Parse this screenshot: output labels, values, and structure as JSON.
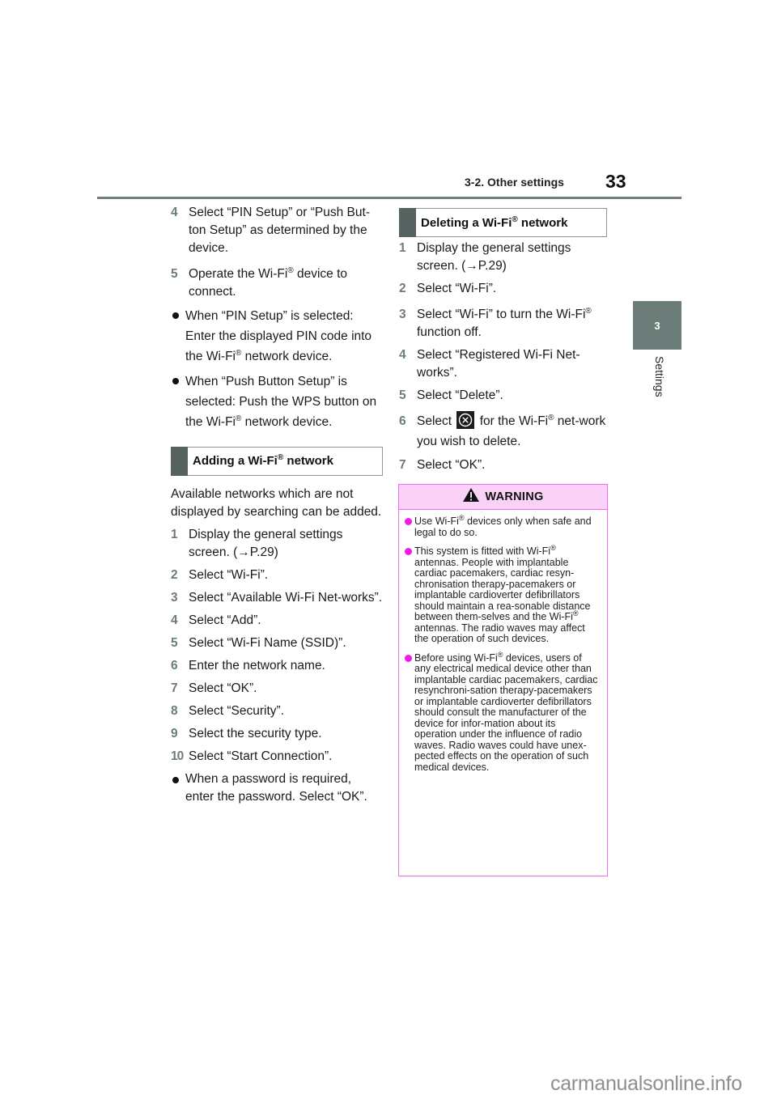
{
  "header": {
    "section": "3-2. Other settings",
    "page_number": "33"
  },
  "side_tab": {
    "chapter_number": "3",
    "chapter_label": "Settings"
  },
  "left_column": {
    "continued_steps": [
      {
        "num": "4",
        "text": "Select “PIN Setup” or “Push But-ton Setup” as determined by the device."
      },
      {
        "num": "5",
        "pre": "Operate the Wi-Fi",
        "sup": "®",
        "post": " device to connect."
      }
    ],
    "bullets": [
      {
        "pre": "When “PIN Setup” is selected: Enter the displayed PIN code into the Wi-Fi",
        "sup": "®",
        "post": " network device."
      },
      {
        "pre": "When “Push Button Setup” is selected: Push the WPS button on the Wi-Fi",
        "sup": "®",
        "post": " network device."
      }
    ],
    "adding_section": {
      "heading_pre": "Adding a Wi-Fi",
      "heading_sup": "®",
      "heading_post": " network",
      "intro": "Available networks which are not displayed by searching can be added.",
      "steps": [
        {
          "num": "1",
          "text": "Display the general settings screen. (→P.29)"
        },
        {
          "num": "2",
          "text": "Select “Wi-Fi”."
        },
        {
          "num": "3",
          "text": "Select “Available Wi-Fi Net-works”."
        },
        {
          "num": "4",
          "text": "Select “Add”."
        },
        {
          "num": "5",
          "text": "Select “Wi-Fi Name (SSID)”."
        },
        {
          "num": "6",
          "text": "Enter the network name."
        },
        {
          "num": "7",
          "text": "Select “OK”."
        },
        {
          "num": "8",
          "text": "Select “Security”."
        },
        {
          "num": "9",
          "text": "Select the security type."
        },
        {
          "num": "10",
          "text": "Select “Start Connection”."
        }
      ],
      "final_bullet": "When a password is required, enter the password. Select “OK”."
    }
  },
  "right_column": {
    "deleting_section": {
      "heading_pre": "Deleting a Wi-Fi",
      "heading_sup": "®",
      "heading_post": " network",
      "steps": [
        {
          "num": "1",
          "text": "Display the general settings screen. (→P.29)"
        },
        {
          "num": "2",
          "text": "Select “Wi-Fi”."
        },
        {
          "num": "3",
          "pre": "Select “Wi-Fi” to turn the Wi-Fi",
          "sup": "®",
          "post": " function off."
        },
        {
          "num": "4",
          "text": "Select “Registered Wi-Fi Net-works”."
        },
        {
          "num": "5",
          "text": "Select “Delete”."
        },
        {
          "num": "6",
          "pre": "Select",
          "icon": "delete-x-icon",
          "mid": " for the Wi-Fi",
          "sup": "®",
          "post": " net-work you wish to delete."
        },
        {
          "num": "7",
          "text": "Select “OK”."
        }
      ]
    },
    "warning": {
      "title": "WARNING",
      "icon": "warning-triangle-icon",
      "accent_color": "#f06de8",
      "header_bg": "#fbd2f7",
      "items": [
        {
          "pre": "Use Wi-Fi",
          "sup": "®",
          "post": " devices only when safe and legal to do so."
        },
        {
          "pre": "This system is fitted with Wi-Fi",
          "sup": "®",
          "mid": " antennas. People with implantable cardiac pacemakers, cardiac resyn-chronisation therapy-pacemakers or implantable cardioverter defibrillators should maintain a rea-sonable distance between them-selves and the Wi-Fi",
          "sup2": "®",
          "post": " antennas. The radio waves may affect the operation of such devices."
        },
        {
          "pre": "Before using Wi-Fi",
          "sup": "®",
          "post": " devices, users of any electrical medical device other than implantable cardiac pacemakers, cardiac resynchroni-sation therapy-pacemakers or implantable cardioverter defibrillators should consult the manufacturer of the device for infor-mation about its operation under the influence of radio waves. Radio waves could have unex-pected effects on the operation of such medical devices."
        }
      ]
    }
  },
  "watermark": "carmanualsonline.info",
  "colors": {
    "rule": "#6f7f7c",
    "tab": "#6b7c79",
    "heading_bar": "#56625f",
    "step_number": "#6b7c79",
    "warning_dot": "#f21ae6"
  }
}
